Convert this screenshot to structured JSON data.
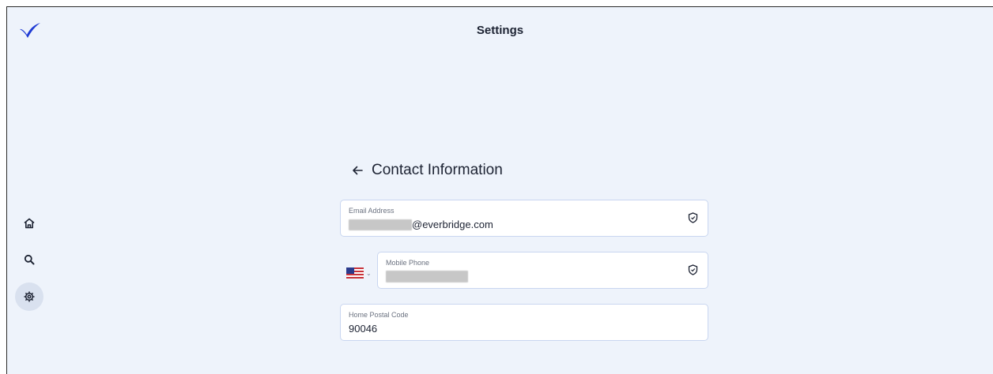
{
  "header": {
    "title": "Settings",
    "logo_icon": "checkmark-logo-icon",
    "logo_color": "#1f3bd4"
  },
  "sidebar": {
    "items": [
      {
        "name": "home",
        "icon": "home-icon",
        "active": false
      },
      {
        "name": "search",
        "icon": "search-icon",
        "active": false
      },
      {
        "name": "settings",
        "icon": "gear-icon",
        "active": true
      }
    ]
  },
  "contact": {
    "heading": "Contact Information",
    "back_icon": "arrow-left-icon",
    "email": {
      "label": "Email Address",
      "value_domain": "@everbridge.com",
      "verified_icon": "shield-check-icon"
    },
    "mobile": {
      "country_flag": "us-flag-icon",
      "label": "Mobile Phone",
      "verified_icon": "shield-check-icon"
    },
    "postal": {
      "label": "Home Postal Code",
      "value": "90046"
    }
  },
  "colors": {
    "background": "#eef3fb",
    "field_border": "#c9d6f0",
    "text": "#1d2333"
  }
}
